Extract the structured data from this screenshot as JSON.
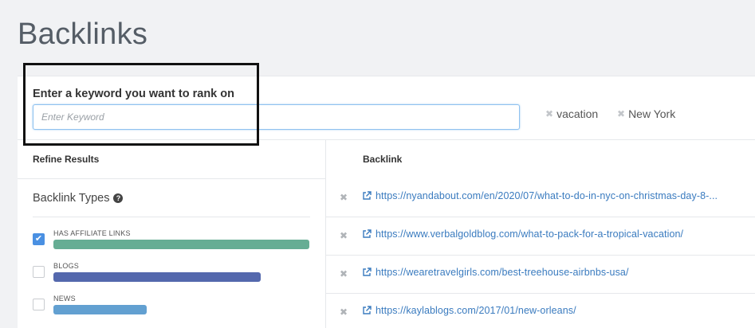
{
  "page": {
    "title": "Backlinks"
  },
  "keyword": {
    "label": "Enter a keyword you want to rank on",
    "placeholder": "Enter Keyword",
    "value": ""
  },
  "chips": [
    {
      "label": "vacation",
      "remove_icon": "close-icon"
    },
    {
      "label": "New York",
      "remove_icon": "close-icon"
    }
  ],
  "columns": {
    "refine": "Refine Results",
    "backlink": "Backlink"
  },
  "backlink_types": {
    "title": "Backlink Types",
    "help_icon": "question-circle-icon",
    "filters": [
      {
        "label": "HAS AFFILIATE LINKS",
        "checked": true,
        "color": "#66ad94"
      },
      {
        "label": "BLOGS",
        "checked": false,
        "color": "#5468ad"
      },
      {
        "label": "NEWS",
        "checked": false,
        "color": "#62a0d1"
      }
    ]
  },
  "backlinks": [
    {
      "url": "https://nyandabout.com/en/2020/07/what-to-do-in-nyc-on-christmas-day-8-..."
    },
    {
      "url": "https://www.verbalgoldblog.com/what-to-pack-for-a-tropical-vacation/"
    },
    {
      "url": "https://wearetravelgirls.com/best-treehouse-airbnbs-usa/"
    },
    {
      "url": "https://kaylablogs.com/2017/01/new-orleans/"
    }
  ],
  "colors": {
    "link": "#3a7bbf",
    "accent": "#4a90e2"
  }
}
